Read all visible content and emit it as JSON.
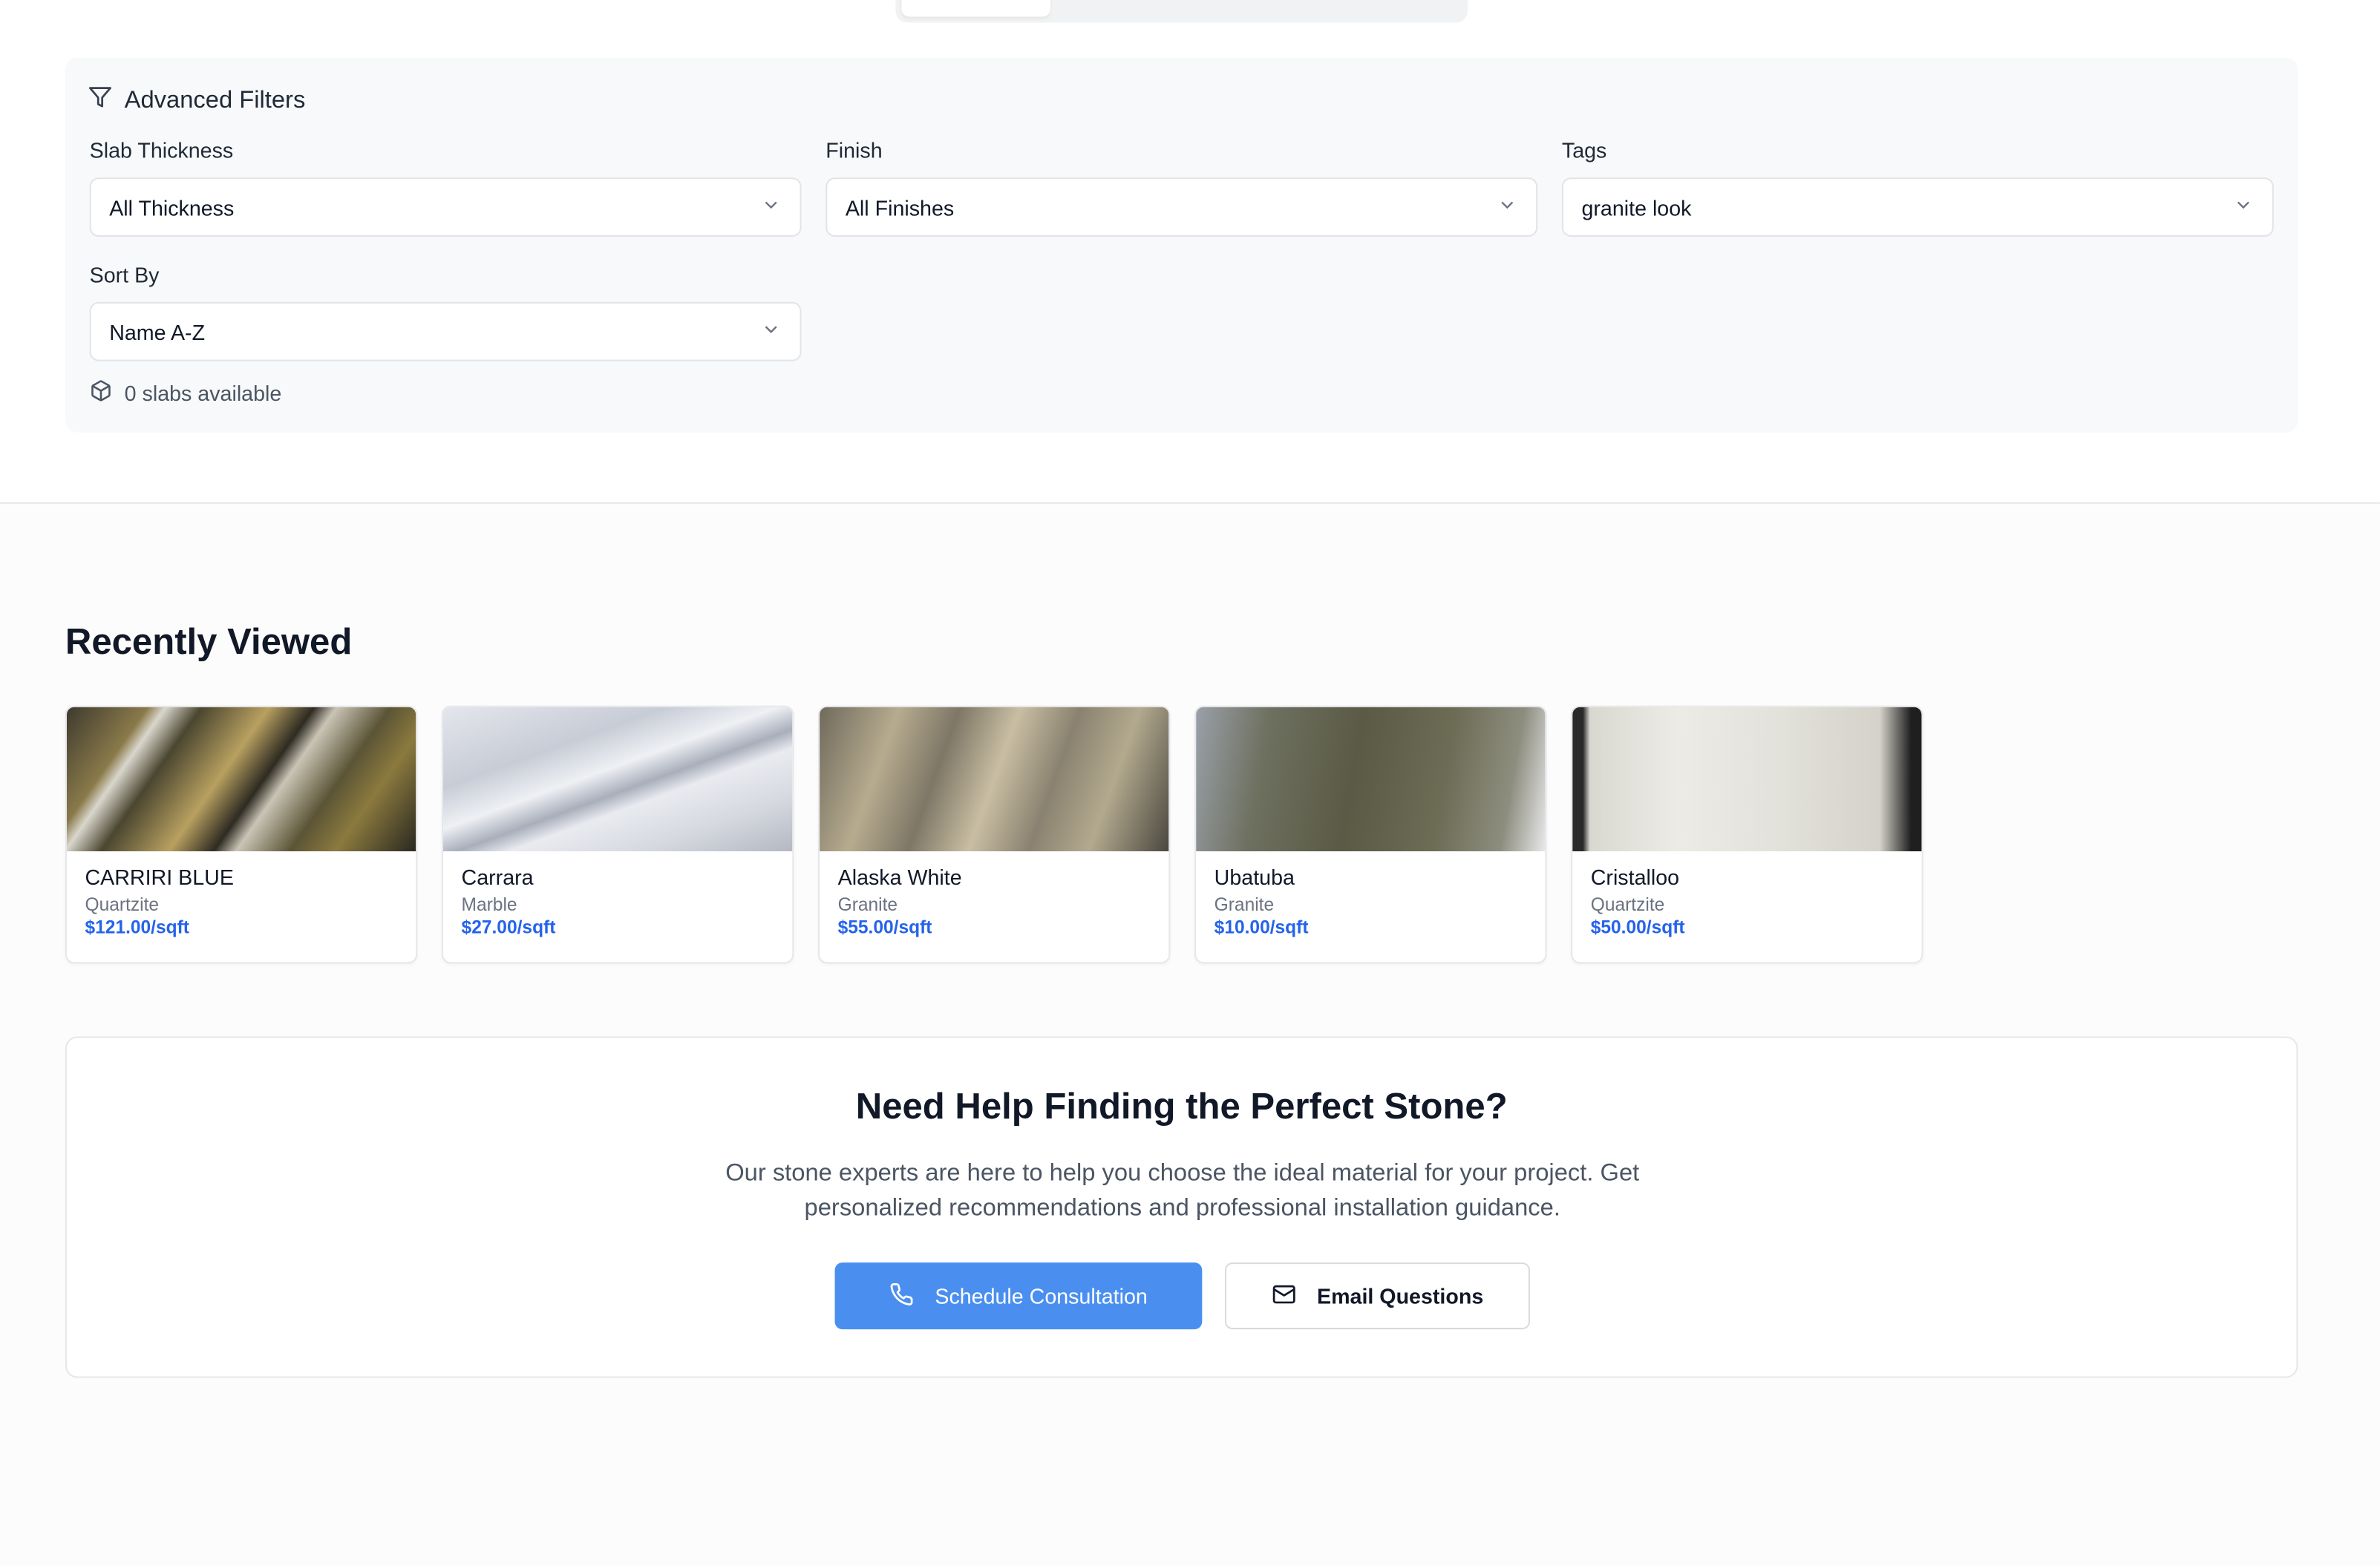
{
  "filters": {
    "title": "Advanced Filters",
    "thickness": {
      "label": "Slab Thickness",
      "value": "All Thickness"
    },
    "finish": {
      "label": "Finish",
      "value": "All Finishes"
    },
    "tags": {
      "label": "Tags",
      "value": "granite look"
    },
    "sort": {
      "label": "Sort By",
      "value": "Name A-Z"
    },
    "count_text": "0 slabs available"
  },
  "recently_viewed": {
    "title": "Recently Viewed",
    "items": [
      {
        "name": "CARRIRI BLUE",
        "type": "Quartzite",
        "price": "$121.00/sqft"
      },
      {
        "name": "Carrara",
        "type": "Marble",
        "price": "$27.00/sqft"
      },
      {
        "name": "Alaska White",
        "type": "Granite",
        "price": "$55.00/sqft"
      },
      {
        "name": "Ubatuba",
        "type": "Granite",
        "price": "$10.00/sqft"
      },
      {
        "name": "Cristalloo",
        "type": "Quartzite",
        "price": "$50.00/sqft"
      }
    ]
  },
  "help": {
    "title": "Need Help Finding the Perfect Stone?",
    "text": "Our stone experts are here to help you choose the ideal material for your project. Get personalized recommendations and professional installation guidance.",
    "primary_label": "Schedule Consultation",
    "secondary_label": "Email Questions"
  },
  "colors": {
    "accent": "#4a8ff0",
    "price": "#2563eb"
  },
  "icons": [
    "filter-icon",
    "chevron-down-icon",
    "package-icon",
    "phone-icon",
    "mail-icon"
  ]
}
